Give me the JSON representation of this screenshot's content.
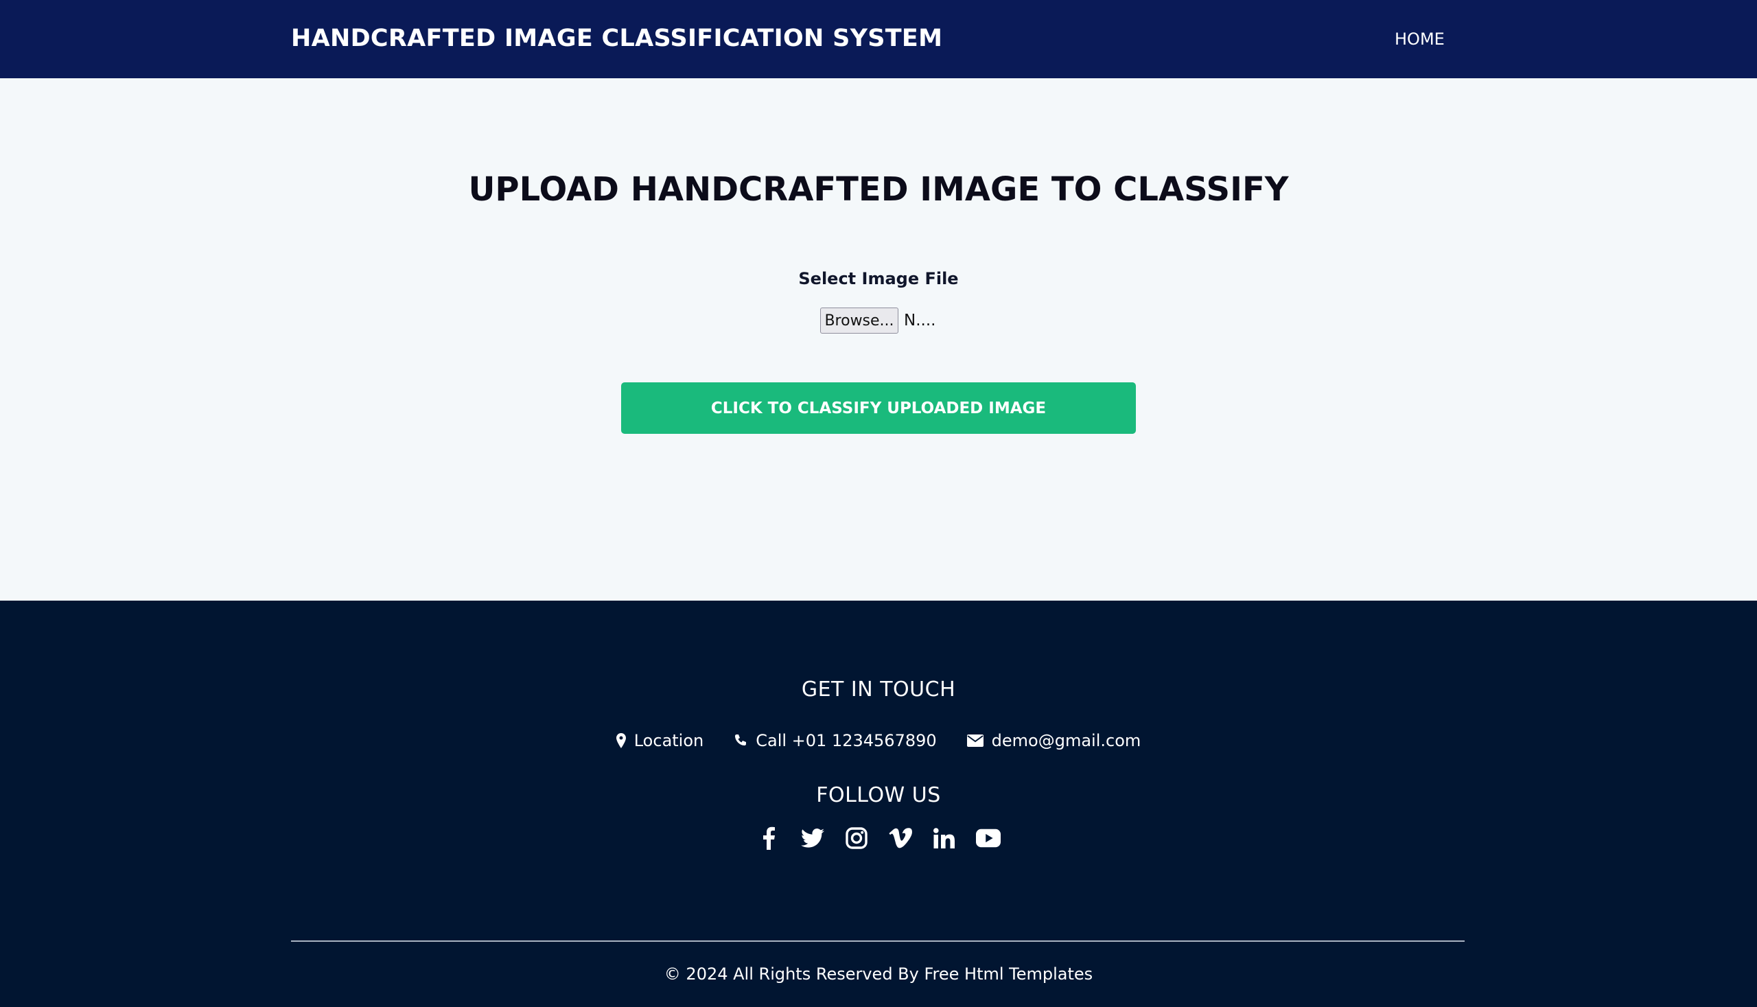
{
  "header": {
    "brand": "HANDCRAFTED IMAGE CLASSIFICATION SYSTEM",
    "nav": {
      "home": "HOME"
    }
  },
  "main": {
    "title": "UPLOAD HANDCRAFTED IMAGE TO CLASSIFY",
    "file_label": "Select Image File",
    "browse_label": "Browse...",
    "file_name": "N....",
    "classify_button": "CLICK TO CLASSIFY UPLOADED IMAGE"
  },
  "footer": {
    "contact_heading": "GET IN TOUCH",
    "contacts": {
      "location": "Location",
      "phone": "Call +01 1234567890",
      "email": "demo@gmail.com"
    },
    "follow_heading": "FOLLOW US",
    "social_icons": [
      "facebook-icon",
      "twitter-icon",
      "instagram-icon",
      "vimeo-icon",
      "linkedin-icon",
      "youtube-icon"
    ],
    "copyright": "© 2024 All Rights Reserved By Free Html Templates"
  },
  "colors": {
    "header_bg": "#0a1a57",
    "footer_bg": "#011531",
    "accent_button": "#1aba7c",
    "page_bg": "#f4f8fa"
  }
}
